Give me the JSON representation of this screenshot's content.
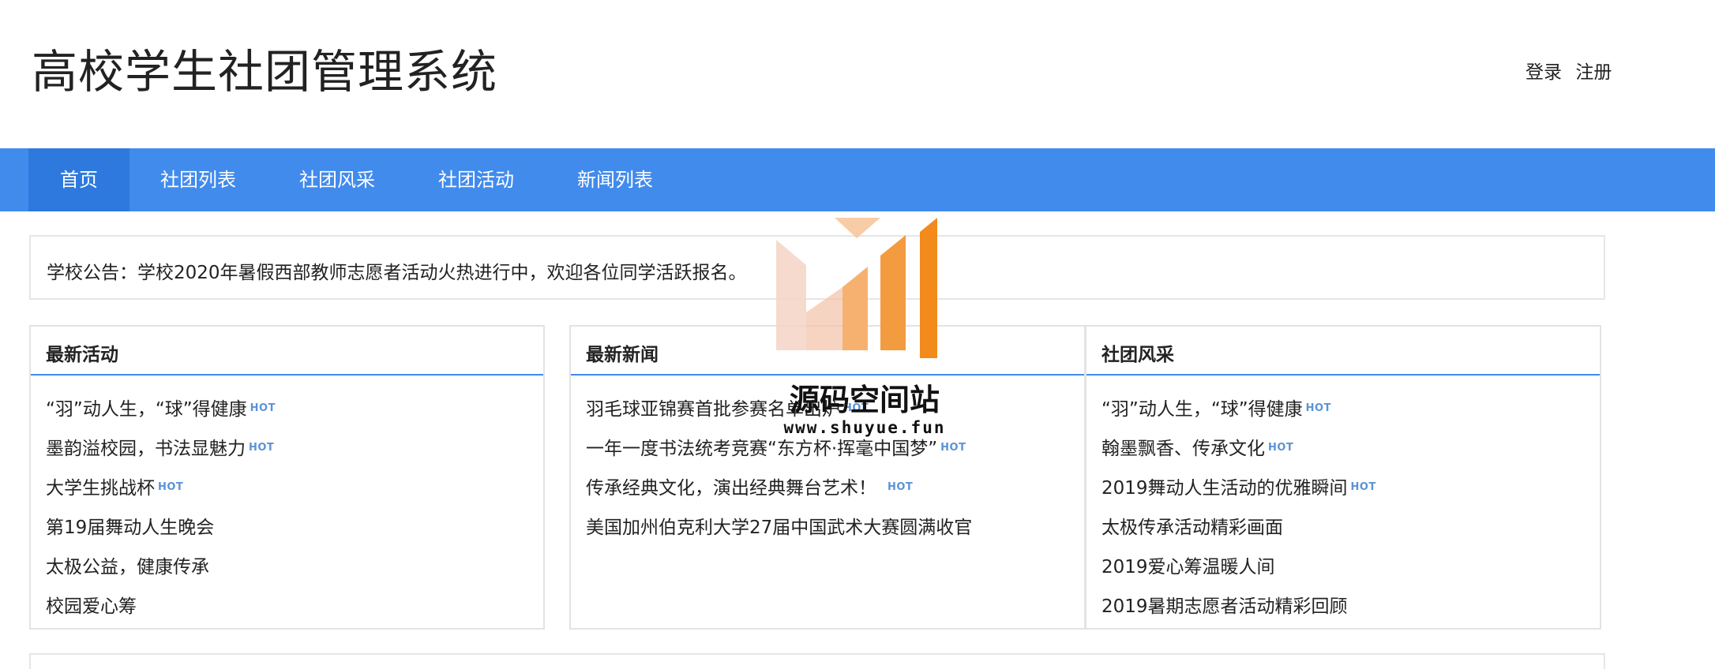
{
  "header": {
    "site_title": "高校学生社团管理系统",
    "login_label": "登录",
    "register_label": "注册"
  },
  "nav": {
    "items": [
      {
        "label": "首页"
      },
      {
        "label": "社团列表"
      },
      {
        "label": "社团风采"
      },
      {
        "label": "社团活动"
      },
      {
        "label": "新闻列表"
      }
    ],
    "active": "首页"
  },
  "notice": {
    "text": "学校公告：学校2020年暑假西部教师志愿者活动火热进行中，欢迎各位同学活跃报名。"
  },
  "panels": {
    "activities": {
      "title": "最新活动",
      "items": [
        {
          "text": "“羽”动人生，“球”得健康",
          "hot": true
        },
        {
          "text": "墨韵溢校园，书法显魅力",
          "hot": true
        },
        {
          "text": "大学生挑战杯",
          "hot": true
        },
        {
          "text": "第19届舞动人生晚会",
          "hot": false
        },
        {
          "text": "太极公益，健康传承",
          "hot": false
        },
        {
          "text": "校园爱心筹",
          "hot": false
        }
      ]
    },
    "news": {
      "title": "最新新闻",
      "items": [
        {
          "text": "羽毛球亚锦赛首批参赛名单出炉",
          "hot": true
        },
        {
          "text": "一年一度书法统考竞赛“东方杯·挥毫中国梦”",
          "hot": true
        },
        {
          "text": "传承经典文化，演出经典舞台艺术！",
          "hot": true
        },
        {
          "text": "美国加州伯克利大学27届中国武术大赛圆满收官",
          "hot": false
        }
      ]
    },
    "showcase": {
      "title": "社团风采",
      "items": [
        {
          "text": "“羽”动人生，“球”得健康",
          "hot": true
        },
        {
          "text": "翰墨飘香、传承文化",
          "hot": true
        },
        {
          "text": "2019舞动人生活动的优雅瞬间",
          "hot": true
        },
        {
          "text": "太极传承活动精彩画面",
          "hot": false
        },
        {
          "text": "2019爱心筹温暖人间",
          "hot": false
        },
        {
          "text": "2019暑期志愿者活动精彩回顾",
          "hot": false
        }
      ]
    }
  },
  "hot_badge": "HOT",
  "watermark": {
    "name": "源码空间站",
    "url": "www.shuyue.fun"
  },
  "colors": {
    "nav_bg": "#418bed",
    "nav_active_bg": "#2e79de",
    "hot_badge": "#5b93d6",
    "watermark_orange": "#f28a1c"
  }
}
